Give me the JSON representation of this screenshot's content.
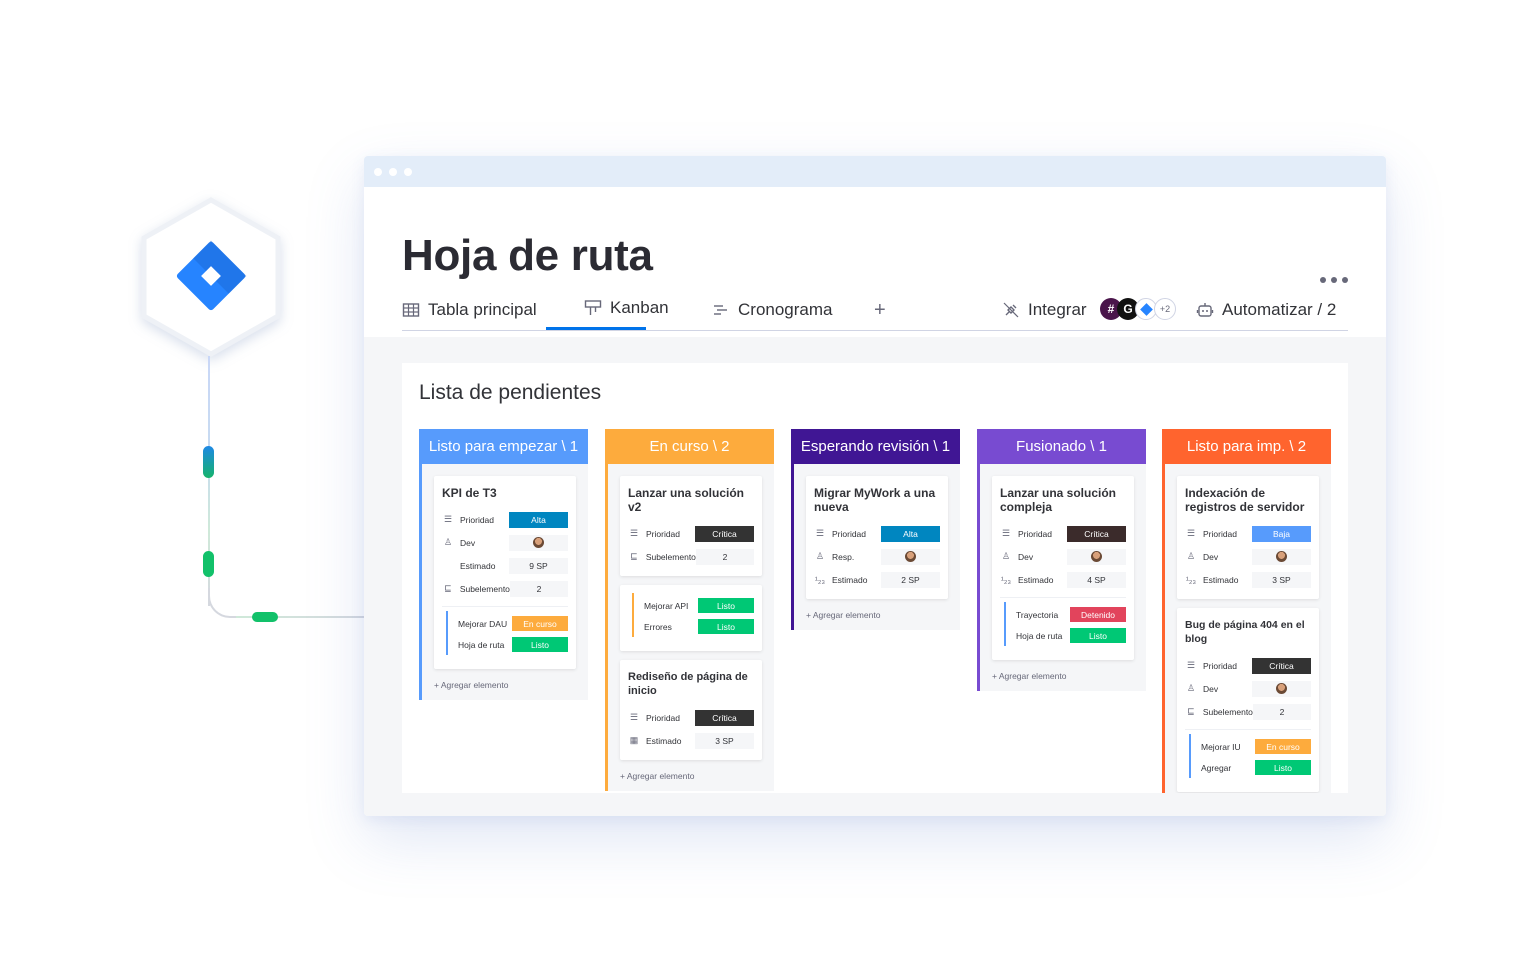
{
  "colors": {
    "blue_header": "#579bfc",
    "orange_header": "#fdab3d",
    "purple_dark_header": "#401694",
    "purple_header": "#784bd1",
    "red_orange_header": "#ff642e",
    "alta": "#0086c0",
    "critica": "#333333",
    "baja": "#579bfc",
    "listo": "#00c875",
    "en_curso": "#fdab3d",
    "detenido": "#e2445c",
    "accent": "#0073ea"
  },
  "app": {
    "logo": "jira-diamond-icon",
    "title": "Hoja de ruta"
  },
  "tabs": [
    {
      "label": "Tabla principal",
      "icon": "table-icon"
    },
    {
      "label": "Kanban",
      "icon": "kanban-icon"
    },
    {
      "label": "Cronograma",
      "icon": "timeline-icon"
    },
    {
      "label": "+"
    }
  ],
  "toolbar": {
    "integrate_label": "Integrar",
    "integrations_more": "+2",
    "automate_label": "Automatizar / 2"
  },
  "board": {
    "title": "Lista de pendientes",
    "add_item_label": "+ Agregar elemento",
    "columns": [
      {
        "title": "Listo para empezar \\ 1",
        "cards": [
          {
            "title": "KPI de T3",
            "rows": [
              {
                "label": "Prioridad",
                "value": "Alta",
                "icon": "list-icon"
              },
              {
                "label": "Dev",
                "value": "",
                "icon": "person-icon"
              },
              {
                "label": "Estimado",
                "value": "9 SP",
                "icon": ""
              },
              {
                "label": "Subelemento",
                "value": "2",
                "icon": "subitem-icon"
              }
            ],
            "subitems": [
              {
                "label": "Mejorar DAU",
                "value": "En curso"
              },
              {
                "label": "Hoja de ruta",
                "value": "Listo"
              }
            ]
          }
        ]
      },
      {
        "title": "En curso \\ 2",
        "cards": [
          {
            "title": "Lanzar una solución v2",
            "rows": [
              {
                "label": "Prioridad",
                "value": "Crítica",
                "icon": "list-icon"
              },
              {
                "label": "Subelemento",
                "value": "2",
                "icon": "subitem-icon"
              }
            ],
            "subitems": [
              {
                "label": "Mejorar API",
                "value": "Listo"
              },
              {
                "label": "Errores",
                "value": "Listo"
              }
            ]
          },
          {
            "title": "Rediseño de página de inicio",
            "rows": [
              {
                "label": "Prioridad",
                "value": "Crítica",
                "icon": "list-icon"
              },
              {
                "label": "Estimado",
                "value": "3 SP",
                "icon": "calendar-icon"
              }
            ]
          }
        ]
      },
      {
        "title": "Esperando revisión \\ 1",
        "cards": [
          {
            "title": "Migrar MyWork a una nueva",
            "rows": [
              {
                "label": "Prioridad",
                "value": "Alta",
                "icon": "list-icon"
              },
              {
                "label": "Resp.",
                "value": "",
                "icon": "person-icon"
              },
              {
                "label": "Estimado",
                "value": "2 SP",
                "icon": "numbers-icon"
              }
            ]
          }
        ]
      },
      {
        "title": "Fusionado \\ 1",
        "cards": [
          {
            "title": "Lanzar una solución compleja",
            "rows": [
              {
                "label": "Prioridad",
                "value": "Crítica",
                "icon": "list-icon"
              },
              {
                "label": "Dev",
                "value": "",
                "icon": "person-icon"
              },
              {
                "label": "Estimado",
                "value": "4 SP",
                "icon": "numbers-icon"
              }
            ],
            "subitems": [
              {
                "label": "Trayectoria",
                "value": "Detenido"
              },
              {
                "label": "Hoja de ruta",
                "value": "Listo"
              }
            ]
          }
        ]
      },
      {
        "title": "Listo para imp. \\ 2",
        "cards": [
          {
            "title": "Indexación de registros de servidor",
            "rows": [
              {
                "label": "Prioridad",
                "value": "Baja",
                "icon": "list-icon"
              },
              {
                "label": "Dev",
                "value": "",
                "icon": "person-icon"
              },
              {
                "label": "Estimado",
                "value": "3 SP",
                "icon": "numbers-icon"
              }
            ]
          },
          {
            "title": "Bug de página 404 en el blog",
            "rows": [
              {
                "label": "Prioridad",
                "value": "Crítica",
                "icon": "list-icon"
              },
              {
                "label": "Dev",
                "value": "",
                "icon": "person-icon"
              },
              {
                "label": "Subelemento",
                "value": "2",
                "icon": "subitem-icon"
              }
            ],
            "subitems": [
              {
                "label": "Mejorar IU",
                "value": "En curso"
              },
              {
                "label": "Agregar",
                "value": "Listo"
              }
            ]
          }
        ]
      }
    ]
  }
}
